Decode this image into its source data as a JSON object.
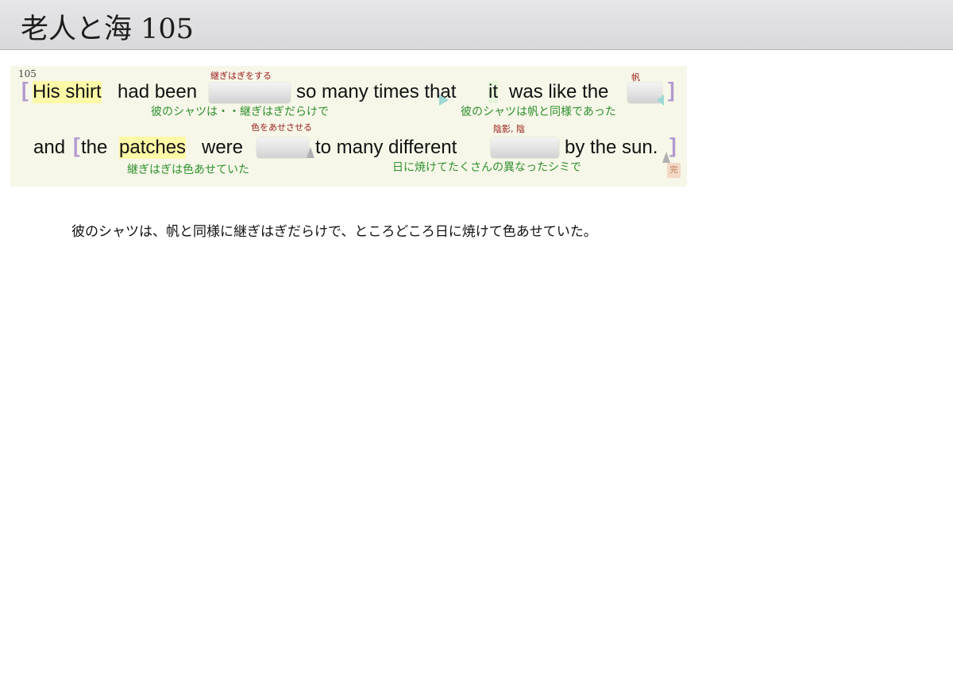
{
  "header": {
    "title": "老人と海 105"
  },
  "panel": {
    "id": "105",
    "line1": {
      "bracket_open": "[",
      "his_shirt": "His shirt",
      "had_been": "had been",
      "so_many_times_that": "so many times that",
      "it": "it",
      "was_like_the": "was like the",
      "bracket_close": "]"
    },
    "line2": {
      "and": "and",
      "bracket_open": "[",
      "the": "the",
      "patches": "patches",
      "were": "were",
      "to_many_different": "to many different",
      "by_the_sun": "by the sun.",
      "bracket_close": "]"
    },
    "hints": {
      "patch": "継ぎはぎをする",
      "sail": "帆",
      "fade": "色をあせさせる",
      "shade": "陰影, 陰"
    },
    "glosses": {
      "g1": "彼のシャツは・・継ぎはぎだらけで",
      "g2": "彼のシャツは帆と同様であった",
      "g3": "継ぎはぎは色あせていた",
      "g4": "日に焼けてたくさんの異なったシミで"
    },
    "seal": "完"
  },
  "translation": "彼のシャツは、帆と同様に継ぎはぎだらけで、ところどころ日に焼けて色あせていた。",
  "colors": {
    "highlight_yellow": "#fdf9a6",
    "gloss_green": "#2f8f2f",
    "hint_red": "#9a1a1a",
    "bracket_purple": "#b29ad0",
    "panel_bg": "#f6f7e8"
  }
}
